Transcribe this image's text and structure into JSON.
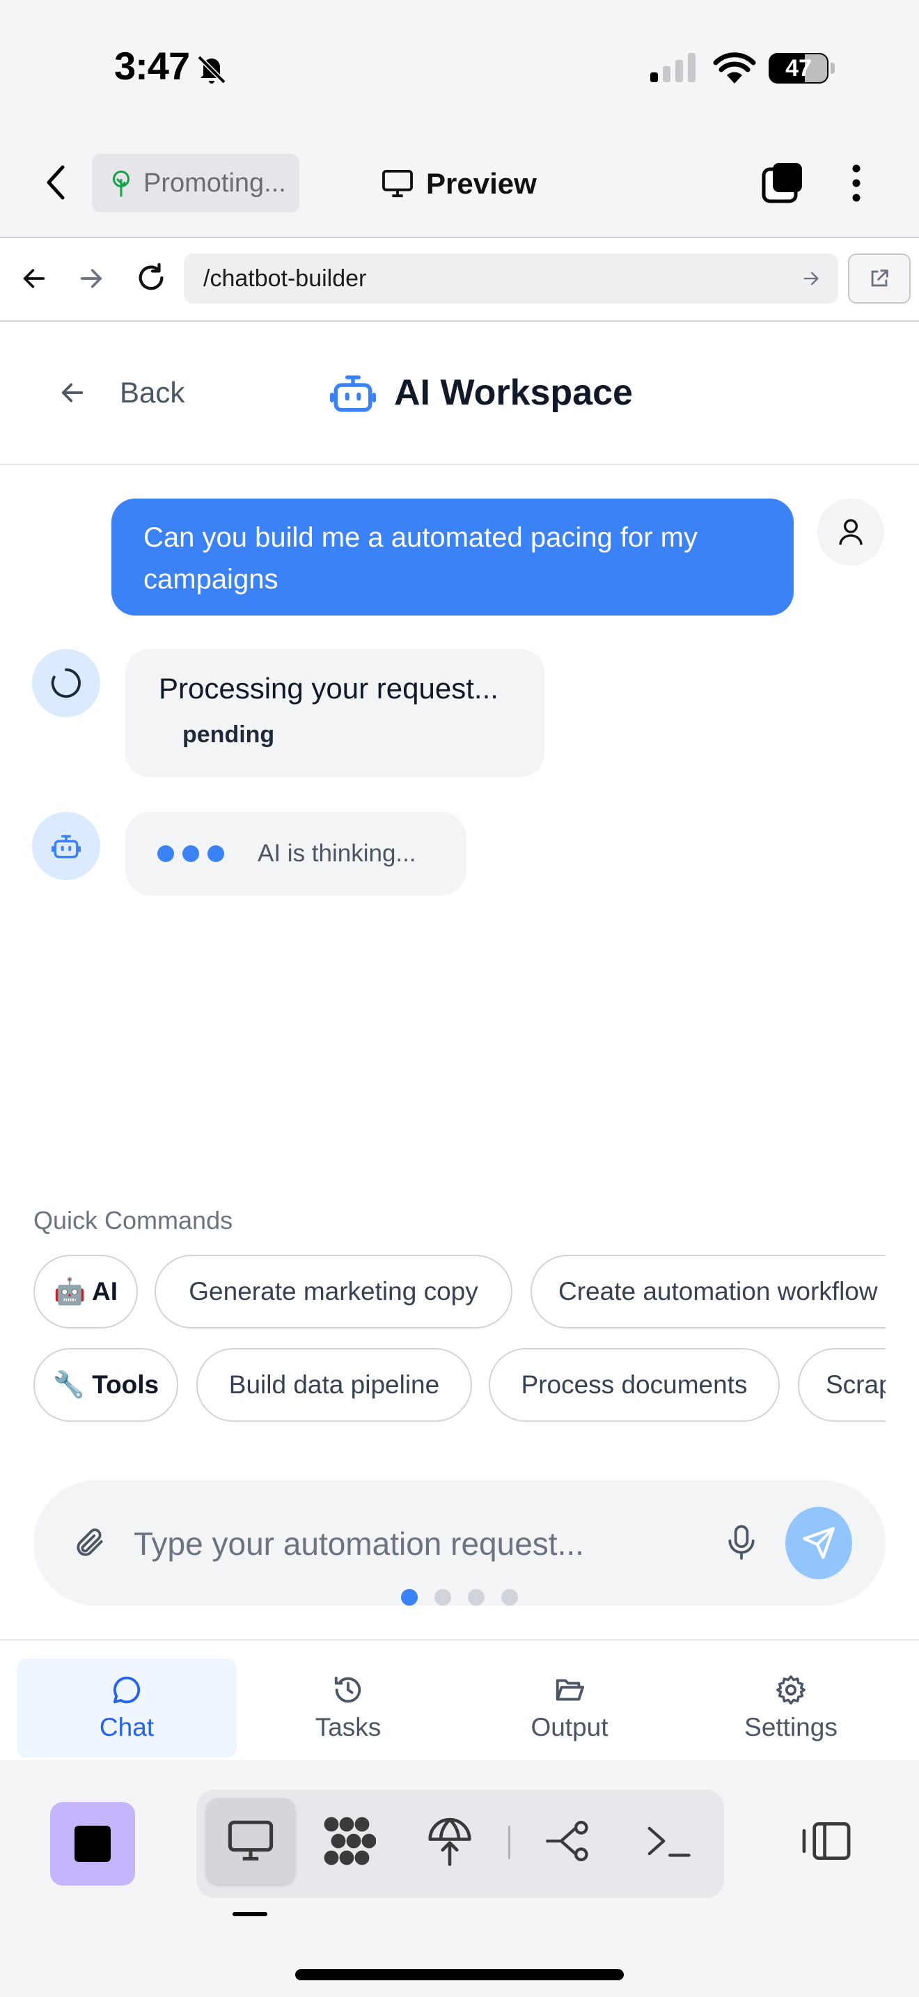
{
  "status_bar": {
    "time": "3:47",
    "battery": "47"
  },
  "header": {
    "project_label": "Promoting...",
    "title": "Preview"
  },
  "browser": {
    "url": "/chatbot-builder"
  },
  "workspace": {
    "back_label": "Back",
    "title": "AI Workspace"
  },
  "chat": {
    "user_message": "Can you build me a automated pacing for my campaigns",
    "processing_text": "Processing your request...",
    "processing_status": "pending",
    "thinking_text": "AI is thinking..."
  },
  "quick_commands": {
    "label": "Quick Commands",
    "ai_row": {
      "category": "🤖 AI",
      "items": [
        "Generate marketing copy",
        "Create automation workflow"
      ]
    },
    "tools_row": {
      "category": "🔧 Tools",
      "items": [
        "Build data pipeline",
        "Process documents",
        "Scrap"
      ]
    }
  },
  "composer": {
    "placeholder": "Type your automation request...",
    "pages": 4,
    "active_page": 1
  },
  "tabs": [
    {
      "label": "Chat",
      "icon": "chat-bubble-icon",
      "active": true
    },
    {
      "label": "Tasks",
      "icon": "history-icon",
      "active": false
    },
    {
      "label": "Output",
      "icon": "folder-open-icon",
      "active": false
    },
    {
      "label": "Settings",
      "icon": "gear-icon",
      "active": false
    }
  ],
  "toolbar": {
    "tools": [
      "monitor-icon",
      "apps-grid-icon",
      "deploy-icon",
      "workflow-icon",
      "terminal-icon"
    ],
    "active_tool": "monitor-icon"
  },
  "colors": {
    "accent": "#3b82f6",
    "accent_light": "#dbeafe",
    "send_button": "#93c5fd",
    "stop_button": "#c4b5fd"
  }
}
